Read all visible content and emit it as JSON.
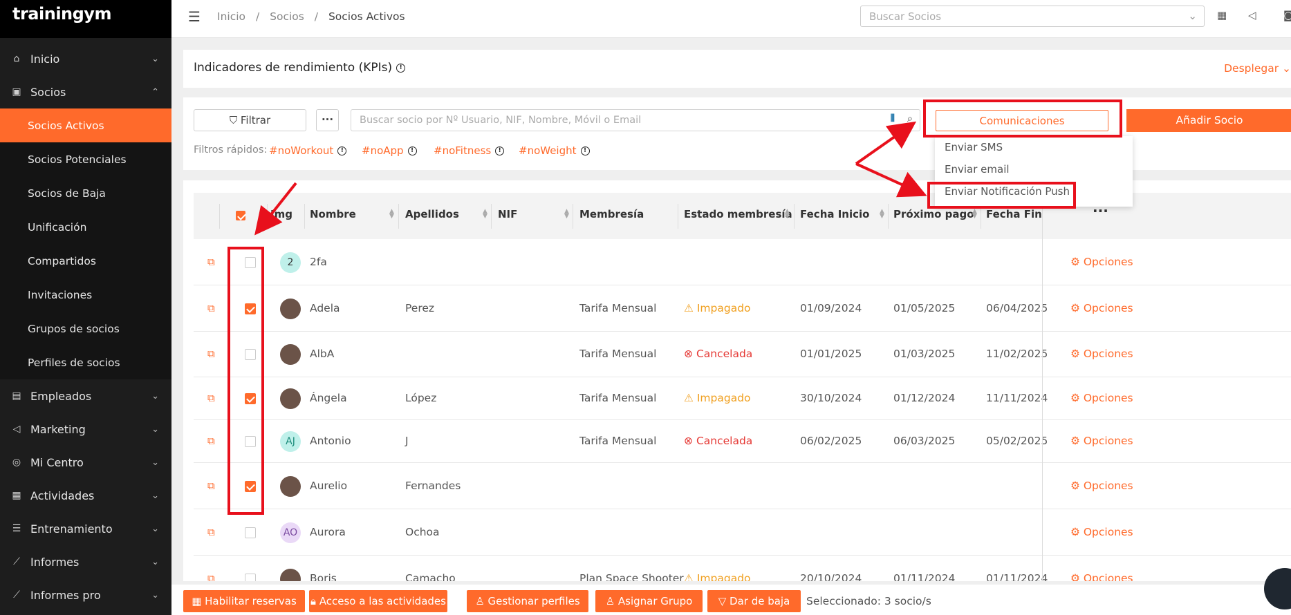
{
  "app": {
    "logo": "trainingym"
  },
  "sidebar": {
    "items": [
      {
        "label": "Inicio",
        "icon": "home-icon"
      },
      {
        "label": "Socios",
        "icon": "users-card-icon"
      }
    ],
    "sub_items": [
      "Socios Activos",
      "Socios Potenciales",
      "Socios de Baja",
      "Unificación",
      "Compartidos",
      "Invitaciones",
      "Grupos de socios",
      "Perfiles de socios"
    ],
    "more_items": [
      {
        "label": "Empleados",
        "icon": "id-card-icon"
      },
      {
        "label": "Marketing",
        "icon": "megaphone-icon"
      },
      {
        "label": "Mi Centro",
        "icon": "location-pin-icon"
      },
      {
        "label": "Actividades",
        "icon": "calendar-icon"
      },
      {
        "label": "Entrenamiento",
        "icon": "list-icon"
      },
      {
        "label": "Informes",
        "icon": "line-chart-icon"
      },
      {
        "label": "Informes pro",
        "icon": "line-chart-pro-icon"
      }
    ]
  },
  "topbar": {
    "breadcrumb": [
      "Inicio",
      "/",
      "Socios",
      "/",
      "Socios Activos"
    ],
    "search_placeholder": "Buscar Socios"
  },
  "kpi": {
    "title": "Indicadores de rendimiento (KPIs)",
    "expand": "Desplegar"
  },
  "filters": {
    "filter_label": "Filtrar",
    "more_label": "···",
    "search_placeholder": "Buscar socio por Nº Usuario, NIF, Nombre, Móvil o Email",
    "comms_label": "Comunicaciones",
    "add_label": "Añadir Socio",
    "quick_label": "Filtros rápidos:",
    "tags": [
      "#noWorkout",
      "#noApp",
      "#noFitness",
      "#noWeight"
    ]
  },
  "dropdown": [
    "Enviar SMS",
    "Enviar email",
    "Enviar Notificación Push"
  ],
  "table": {
    "headers": [
      "Img",
      "Nombre",
      "Apellidos",
      "NIF",
      "Membresía",
      "Estado membresía",
      "Fecha Inicio",
      "Próximo pago",
      "Fecha Fin",
      "···"
    ],
    "rows": [
      {
        "avatar": "2",
        "nombre": "2fa",
        "apellidos": "",
        "membresia": "",
        "estado": "",
        "inicio": "",
        "pago": "",
        "fin": "",
        "checked": false
      },
      {
        "avatar": "",
        "nombre": "Adela",
        "apellidos": "Perez",
        "membresia": "Tarifa Mensual",
        "estado": "Impagado",
        "inicio": "01/09/2024",
        "pago": "01/05/2025",
        "fin": "06/04/2025",
        "checked": true
      },
      {
        "avatar": "",
        "nombre": "AlbA",
        "apellidos": "",
        "membresia": "Tarifa Mensual",
        "estado": "Cancelada",
        "inicio": "01/01/2025",
        "pago": "01/03/2025",
        "fin": "11/02/2025",
        "checked": false
      },
      {
        "avatar": "",
        "nombre": "Ángela",
        "apellidos": "López",
        "membresia": "Tarifa Mensual",
        "estado": "Impagado",
        "inicio": "30/10/2024",
        "pago": "01/12/2024",
        "fin": "11/11/2024",
        "checked": true
      },
      {
        "avatar": "AJ",
        "nombre": "Antonio",
        "apellidos": "J",
        "membresia": "Tarifa Mensual",
        "estado": "Cancelada",
        "inicio": "06/02/2025",
        "pago": "06/03/2025",
        "fin": "05/02/2025",
        "checked": false
      },
      {
        "avatar": "",
        "nombre": "Aurelio",
        "apellidos": "Fernandes",
        "membresia": "",
        "estado": "",
        "inicio": "",
        "pago": "",
        "fin": "",
        "checked": true
      },
      {
        "avatar": "AO",
        "nombre": "Aurora",
        "apellidos": "Ochoa",
        "membresia": "",
        "estado": "",
        "inicio": "",
        "pago": "",
        "fin": "",
        "checked": false
      },
      {
        "avatar": "",
        "nombre": "Boris",
        "apellidos": "Camacho",
        "membresia": "Plan Space Shooter",
        "estado": "Impagado",
        "inicio": "20/10/2024",
        "pago": "01/11/2024",
        "fin": "01/11/2024",
        "checked": false
      }
    ],
    "options_label": "Opciones"
  },
  "bottom": {
    "buttons": [
      "Habilitar reservas",
      "Acceso a las actividades",
      "Gestionar perfiles",
      "Asignar Grupo",
      "Dar de baja"
    ],
    "selected": "Seleccionado: 3 socio/s"
  },
  "colors": {
    "accent": "#ff6a2b",
    "sidebar": "#1d1d1d",
    "annotation": "#e8101c"
  }
}
